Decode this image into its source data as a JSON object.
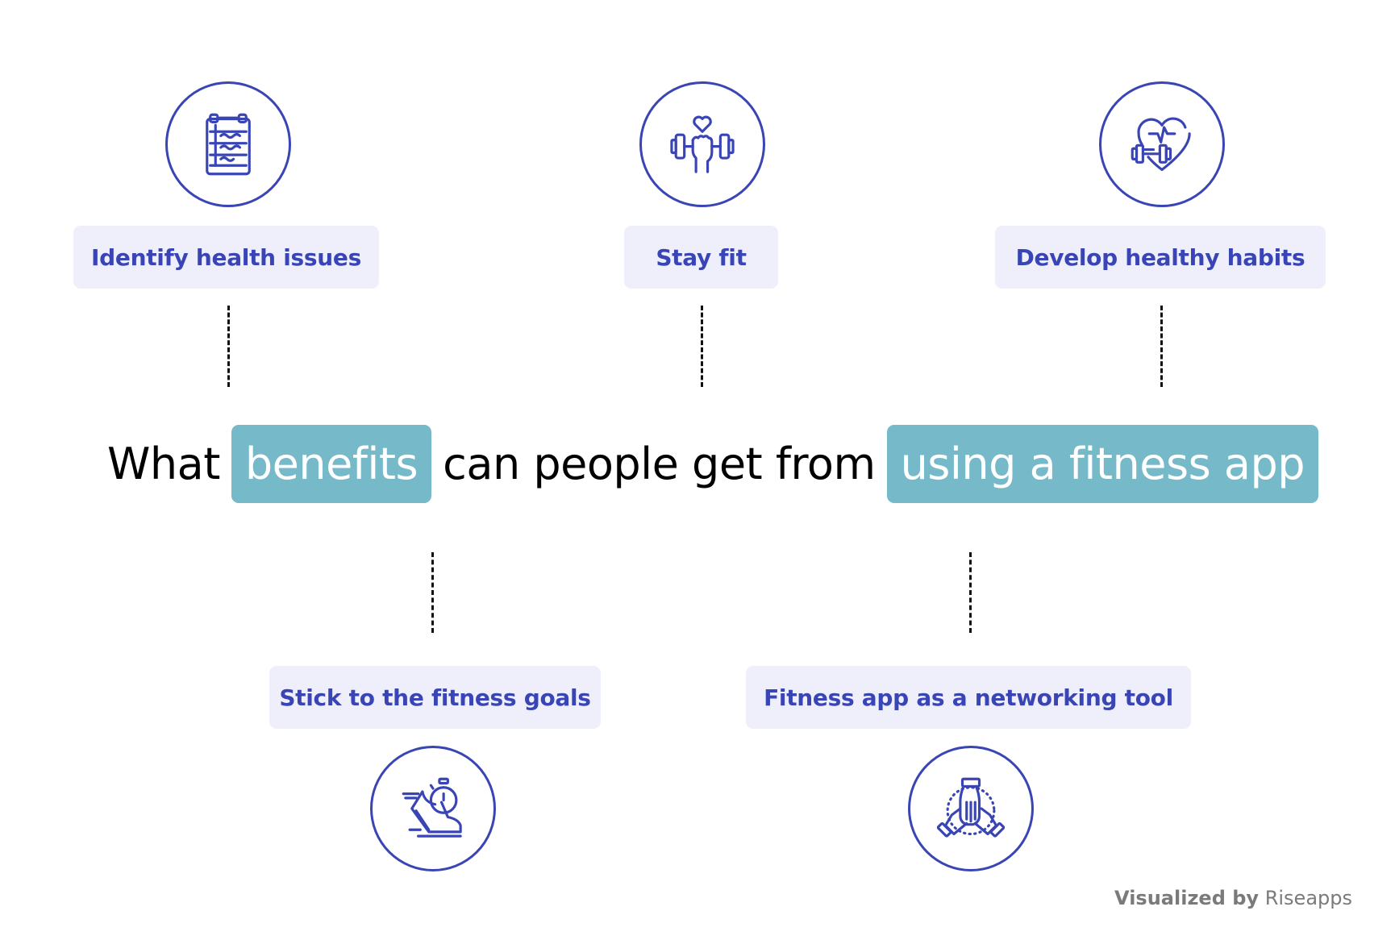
{
  "headline": {
    "part1": "What",
    "highlight1": "benefits",
    "part2": "can people get from",
    "highlight2": "using a fitness app"
  },
  "benefits_top": [
    {
      "label": "Identify health issues",
      "icon": "clipboard-chart-icon"
    },
    {
      "label": "Stay fit",
      "icon": "dumbbell-heart-icon"
    },
    {
      "label": "Develop healthy habits",
      "icon": "heart-dumbbell-icon"
    }
  ],
  "benefits_bottom": [
    {
      "label": "Stick to the fitness goals",
      "icon": "running-shoe-stopwatch-icon"
    },
    {
      "label": "Fitness app as a networking tool",
      "icon": "team-hands-icon"
    }
  ],
  "footer": {
    "prefix": "Visualized by",
    "brand": "Riseapps"
  },
  "colors": {
    "accent": "#3a45b5",
    "label_bg": "#efeffb",
    "highlight": "#76b9c8",
    "footer": "#7a7a7a"
  }
}
